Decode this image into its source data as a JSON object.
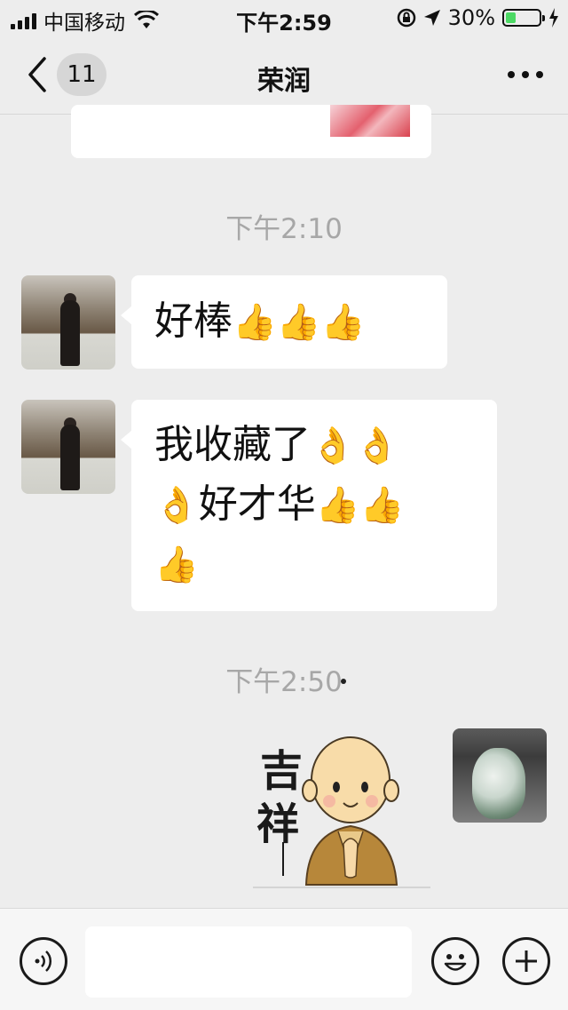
{
  "status_bar": {
    "carrier": "中国移动",
    "time": "下午2:59",
    "battery_percent": "30%",
    "battery_level": 0.3
  },
  "nav": {
    "back_icon": "chevron-left-icon",
    "unread_badge": "11",
    "title": "荣润",
    "more_icon": "ellipsis-icon"
  },
  "chat": {
    "timestamps": [
      "下午2:10",
      "下午2:50"
    ],
    "messages": [
      {
        "side": "left",
        "text": "好棒",
        "emoji": "👍👍👍"
      },
      {
        "side": "left",
        "line1": "我收藏了",
        "line1_emoji": "👌👌",
        "line2_emoji": "👌",
        "line2": "好才华",
        "line2_emoji_end": "👍👍",
        "line3_emoji": "👍"
      }
    ],
    "sticker": {
      "chars": [
        "吉",
        "祥"
      ]
    }
  },
  "input_bar": {
    "voice_icon": "voice-icon",
    "emoji_icon": "smiley-icon",
    "plus_icon": "plus-icon",
    "text_value": ""
  },
  "colors": {
    "background": "#ededed",
    "bubble": "#ffffff",
    "timestamp": "#a7a7a7",
    "battery_fill": "#4cd964"
  }
}
